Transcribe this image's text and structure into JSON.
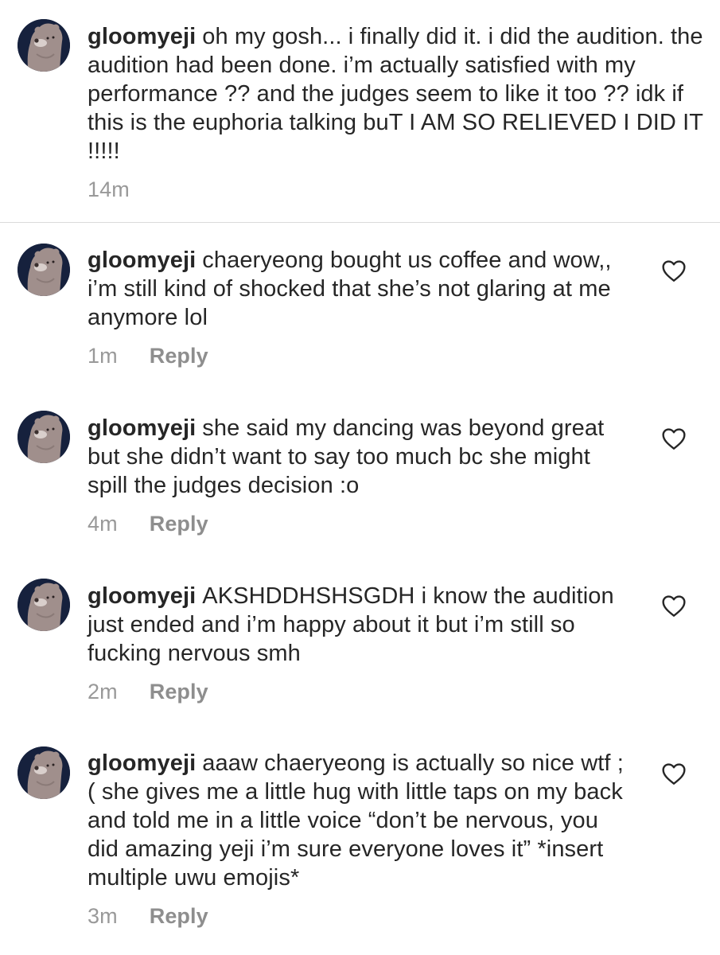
{
  "comments": [
    {
      "username": "gloomyeji",
      "text": "oh my gosh... i finally did it. i did the audition. the audition had been done. i’m actually satisfied with my performance ?? and the judges seem to like it too ?? idk if this is the euphoria talking buT I AM SO RELIEVED I DID IT !!!!!",
      "time": "14m",
      "reply_label": ""
    },
    {
      "username": "gloomyeji",
      "text": "chaeryeong bought us coffee and wow,, i’m still kind of shocked that she’s not glaring at me anymore lol",
      "time": "1m",
      "reply_label": "Reply"
    },
    {
      "username": "gloomyeji",
      "text": "she said my dancing was beyond great but she didn’t want to say too much bc she might spill the judges decision :o",
      "time": "4m",
      "reply_label": "Reply"
    },
    {
      "username": "gloomyeji",
      "text": "AKSHDDHSHSGDH i know the audition just ended and i’m happy about it but i’m still so fucking nervous smh",
      "time": "2m",
      "reply_label": "Reply"
    },
    {
      "username": "gloomyeji",
      "text": "aaaw chaeryeong is actually so nice wtf ;( she gives me a little hug with little taps on my back and told me in a little voice “don’t be nervous, you did amazing yeji i’m sure everyone loves it” *insert multiple uwu emojis*",
      "time": "3m",
      "reply_label": "Reply"
    }
  ],
  "icons": {
    "avatar": "bear-avatar-icon",
    "like": "heart-outline-icon"
  },
  "colors": {
    "text": "#262626",
    "meta": "#999999",
    "divider": "#dbdbdb",
    "avatar_bg": "#16213d",
    "bear": "#a08f8c"
  }
}
